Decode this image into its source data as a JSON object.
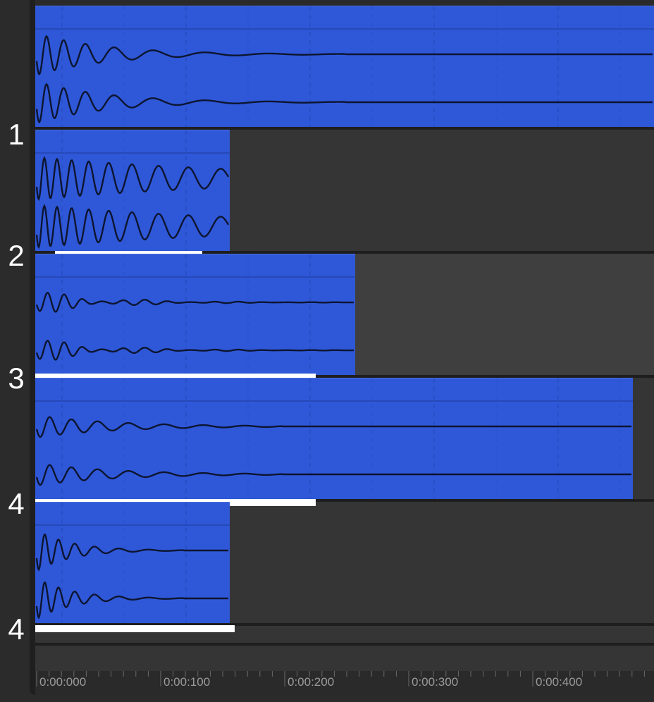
{
  "tracks": [
    {
      "label": "1"
    },
    {
      "label": "2"
    },
    {
      "label": "3"
    },
    {
      "label": "4"
    },
    {
      "label": "4"
    }
  ],
  "ruler": {
    "labels": [
      "0:00:000",
      "0:00:100",
      "0:00:200",
      "0:00:300",
      "0:00:400"
    ]
  },
  "colors": {
    "clip": "#2f58d8",
    "waveform": "#0d1530",
    "range_bar": "#ffffff",
    "background": "#353535"
  }
}
